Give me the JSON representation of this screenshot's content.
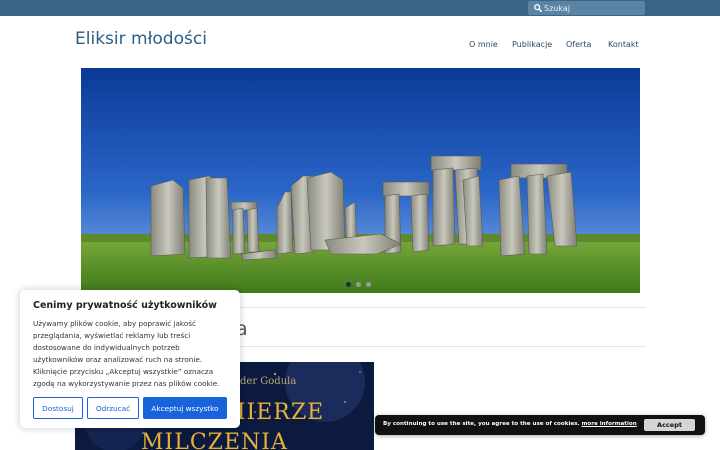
{
  "search": {
    "placeholder": "Szukaj"
  },
  "header": {
    "site_title": "Eliksir młodości"
  },
  "nav": {
    "items": [
      {
        "label": "O mnie"
      },
      {
        "label": "Publikacje"
      },
      {
        "label": "Oferta"
      },
      {
        "label": "Kontakt"
      }
    ]
  },
  "slider": {
    "slide_count": 3,
    "active_index": 0,
    "image": "stonehenge-photo"
  },
  "post": {
    "title_partial": "a"
  },
  "book": {
    "author_partial": "der Godula",
    "title_line1": "MIERZE",
    "title_line2": "MILCZENIA"
  },
  "privacy": {
    "title": "Cenimy prywatność użytkowników",
    "lines": [
      "Używamy plików cookie, aby poprawić jakość",
      "przeglądania, wyświetlać reklamy lub treści",
      "dostosowane do indywidualnych potrzeb",
      "użytkowników oraz analizować ruch na stronie.",
      "Kliknięcie przycisku „Akceptuj wszystkie” oznacza",
      "zgodę na wykorzystywanie przez nas plików cookie."
    ],
    "customize_label": "Dostosuj",
    "reject_label": "Odrzucać",
    "accept_label": "Akceptuj wszystko",
    "accent_color": "#1863dc"
  },
  "cookiebar": {
    "text": "By continuing to use the site, you agree to the use of cookies.",
    "more_label": "more information",
    "accept_label": "Accept"
  },
  "colors": {
    "topbar": "#3a6485",
    "site_title": "#2e5e86"
  }
}
